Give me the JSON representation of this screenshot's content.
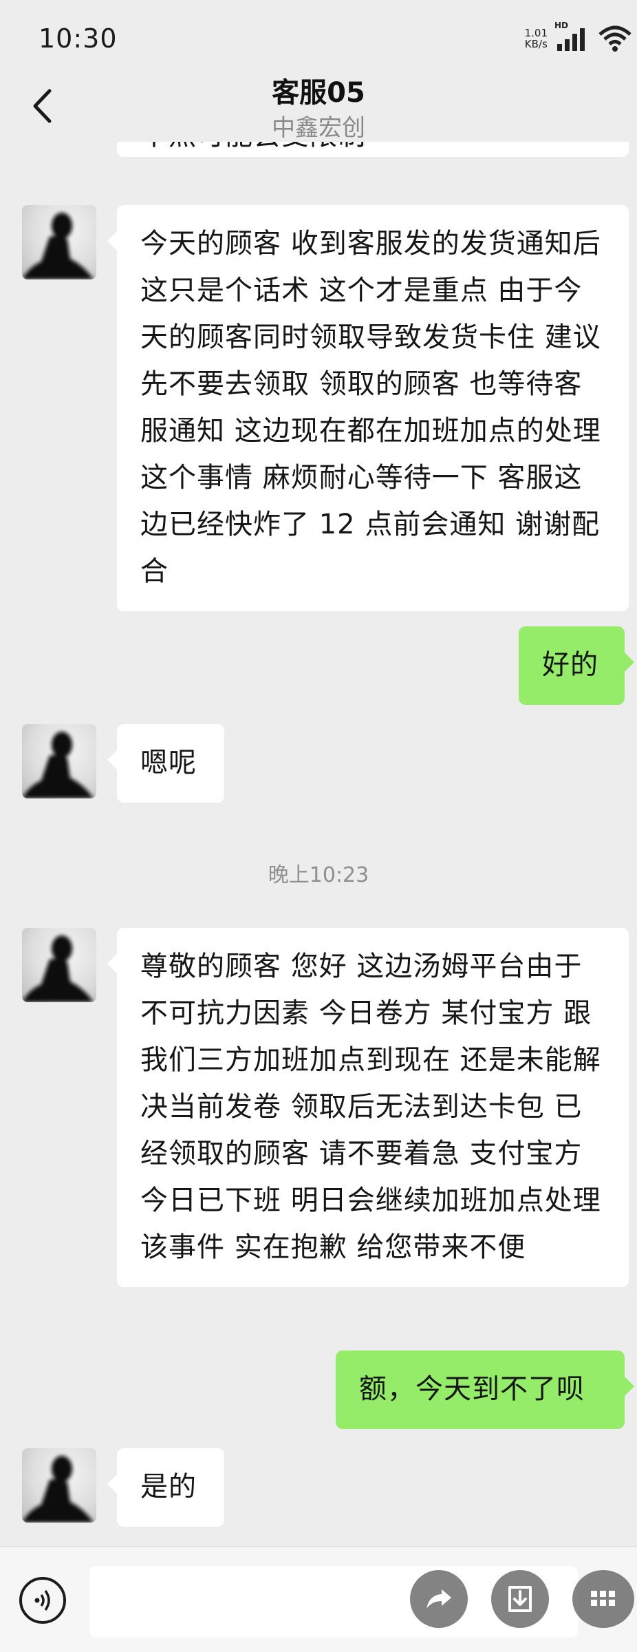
{
  "status_bar": {
    "time": "10:30",
    "net_speed_value": "1.01",
    "net_speed_unit": "KB/s",
    "hd_label": "HD",
    "signal_icon": "signal-bars-icon",
    "wifi_icon": "wifi-icon"
  },
  "header": {
    "title": "客服05",
    "subtitle": "中鑫宏创",
    "back_icon": "chevron-left-icon"
  },
  "messages": {
    "cut_off": "不然可能会受限制",
    "m1": "今天的顾客 收到客服发的发货通知后这只是个话术 这个才是重点 由于今天的顾客同时领取导致发货卡住 建议先不要去领取 领取的顾客 也等待客服通知 这边现在都在加班加点的处理这个事情 麻烦耐心等待一下 客服这边已经快炸了 12 点前会通知 谢谢配合",
    "m2": "好的",
    "m3": "嗯呢",
    "timestamp": "晚上10:23",
    "m4": "尊敬的顾客 您好 这边汤姆平台由于不可抗力因素 今日卷方 某付宝方 跟我们三方加班加点到现在 还是未能解决当前发卷 领取后无法到达卡包 已经领取的顾客 请不要着急 支付宝方今日已下班 明日会继续加班加点处理该事件 实在抱歉 给您带来不便",
    "m5": "额，今天到不了呗",
    "m6": "是的"
  },
  "colors": {
    "background": "#ededed",
    "incoming_bubble": "#ffffff",
    "outgoing_bubble": "#95ec69",
    "timestamp_text": "#8f8f8f"
  },
  "input_bar": {
    "voice_icon": "voice-icon",
    "share_icon": "share-arrow-icon",
    "download_icon": "download-icon",
    "more_icon": "grid-icon",
    "text_value": ""
  }
}
